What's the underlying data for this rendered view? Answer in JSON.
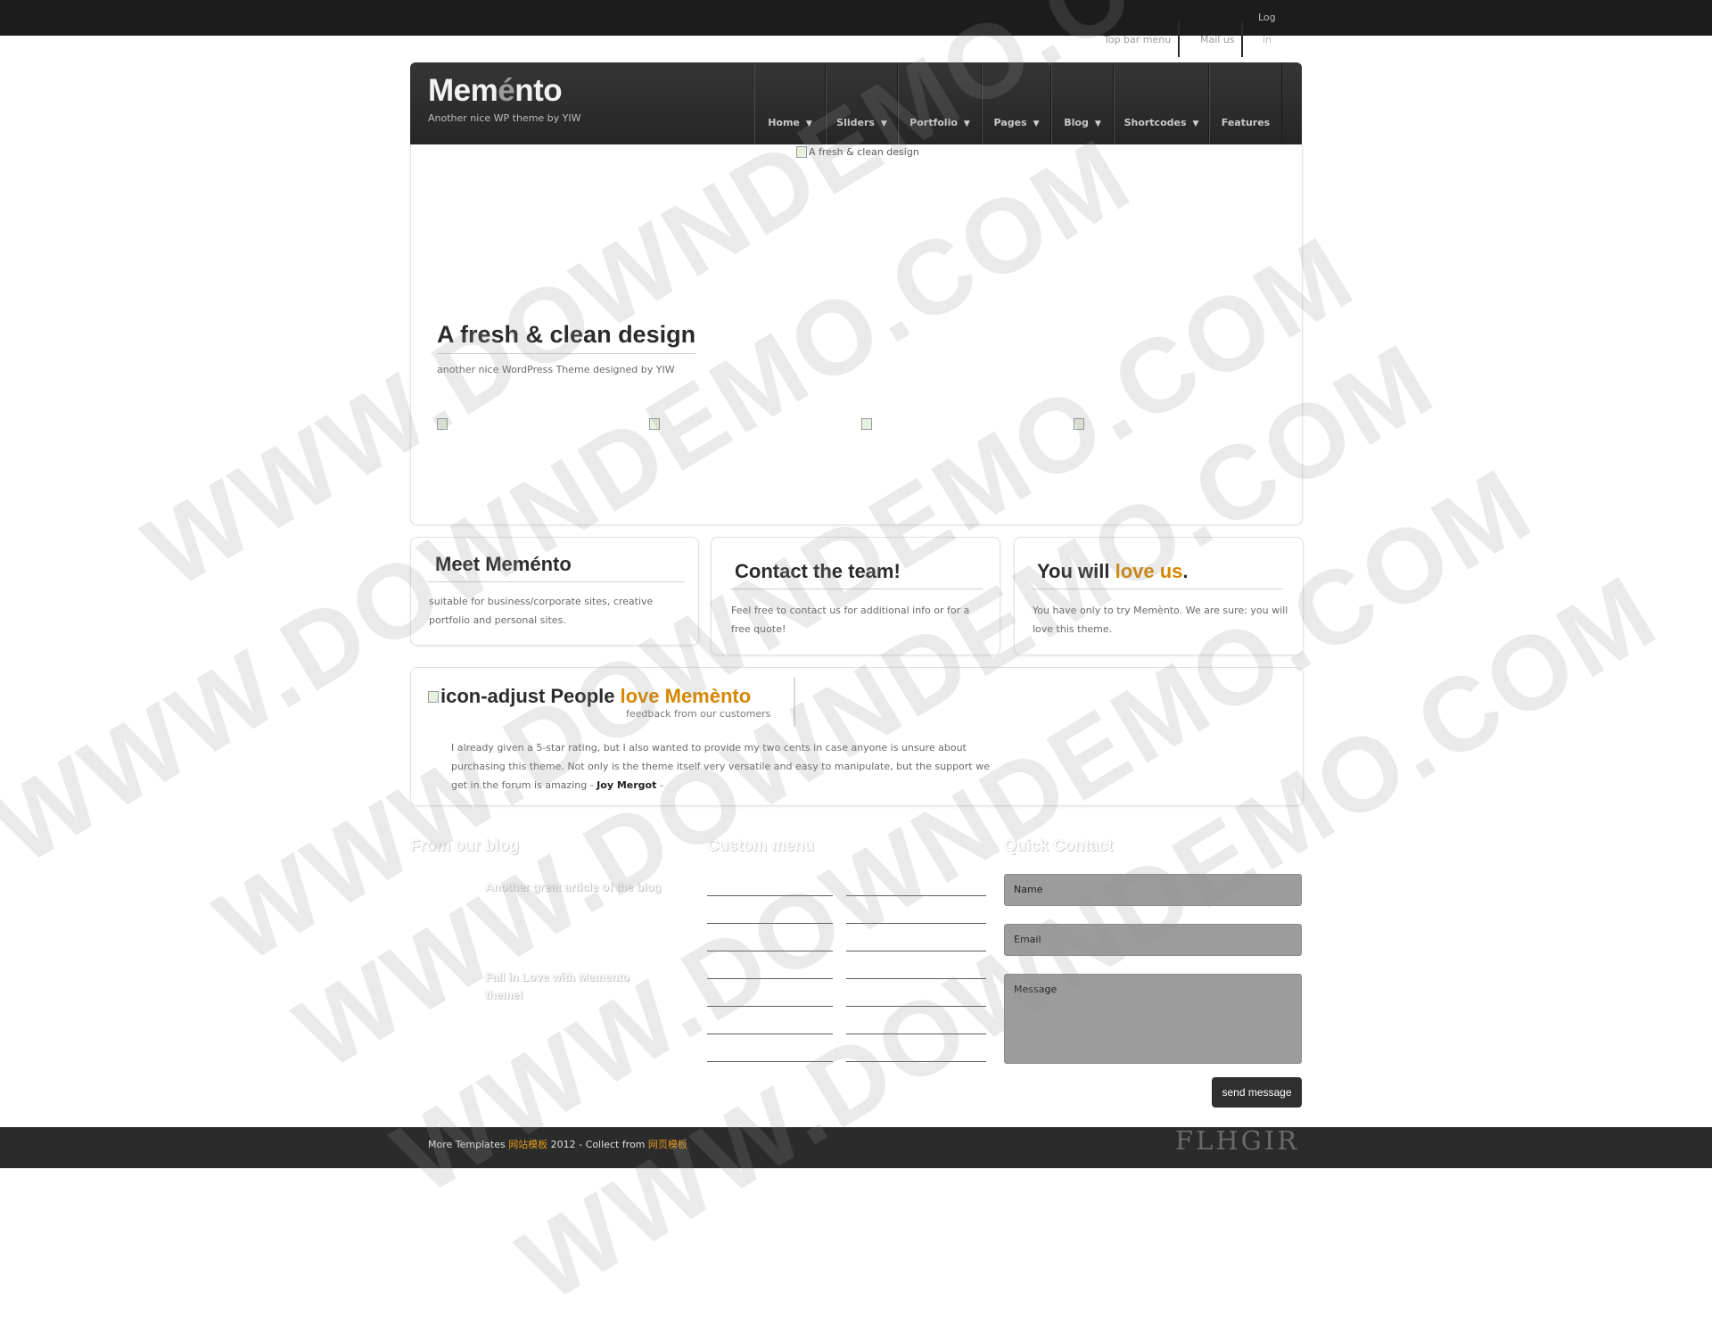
{
  "topbar": {
    "menu_label": "Top bar menu",
    "mail_label": "Mail us",
    "login_line1": "Log",
    "login_line2": "in"
  },
  "header": {
    "logo_prefix": "Mem",
    "logo_accent": "é",
    "logo_suffix": "nto",
    "tagline": "Another nice WP theme by YIW"
  },
  "nav": {
    "items": [
      {
        "label": "Home",
        "has_dropdown": true
      },
      {
        "label": "Sliders",
        "has_dropdown": true
      },
      {
        "label": "Portfolio",
        "has_dropdown": true
      },
      {
        "label": "Pages",
        "has_dropdown": true
      },
      {
        "label": "Blog",
        "has_dropdown": true
      },
      {
        "label": "Shortcodes",
        "has_dropdown": true
      },
      {
        "label": "Features",
        "has_dropdown": false
      }
    ],
    "dropdown_icon": "chevron-down-icon"
  },
  "slider": {
    "image_alt": "A fresh & clean design",
    "title": "A fresh & clean design",
    "subtitle": "another nice WordPress Theme designed by YIW",
    "thumb_count_icon": "broken-image-icon"
  },
  "boxes": [
    {
      "title": "Meet Meménto",
      "text": "suitable for business/corporate sites, creative portfolio and personal sites."
    },
    {
      "title": "Contact the team!",
      "text": "Feel free to contact us for additional info or for a free quote!"
    },
    {
      "title_prefix": "You will ",
      "title_accent": "love us",
      "title_suffix": ".",
      "text": "You have only to try Memènto. We are sure: you will love this theme."
    }
  ],
  "testimonials": {
    "icon_alt": "icon-adjust",
    "title": "People",
    "title_accent": "love Memènto",
    "subtitle": "feedback from our customers",
    "quote": "I already given a 5-star rating, but I also wanted to provide my two cents in case anyone is unsure about purchasing this theme. Not only is the theme itself very versatile and easy to manipulate, but the support we get in the forum is amazing -",
    "author": "Joy Mergot",
    "author_suffix": "-"
  },
  "blog": {
    "title": "From our blog",
    "posts": [
      "Another great article of the blog",
      "Fall in Love with Memento theme!"
    ]
  },
  "custom_menu": {
    "title": "Custom menu"
  },
  "quick_contact": {
    "title": "Quick Contact",
    "name_placeholder": "Name",
    "email_placeholder": "Email",
    "message_placeholder": "Message",
    "send_label": "send message"
  },
  "footer": {
    "text1": "More Templates ",
    "link1": "网站模板",
    "text2": " 2012 - Collect from ",
    "link2": "网页模板",
    "logo": "FLHGIR"
  },
  "watermark": "WWW.DOWNDEMO.COM"
}
